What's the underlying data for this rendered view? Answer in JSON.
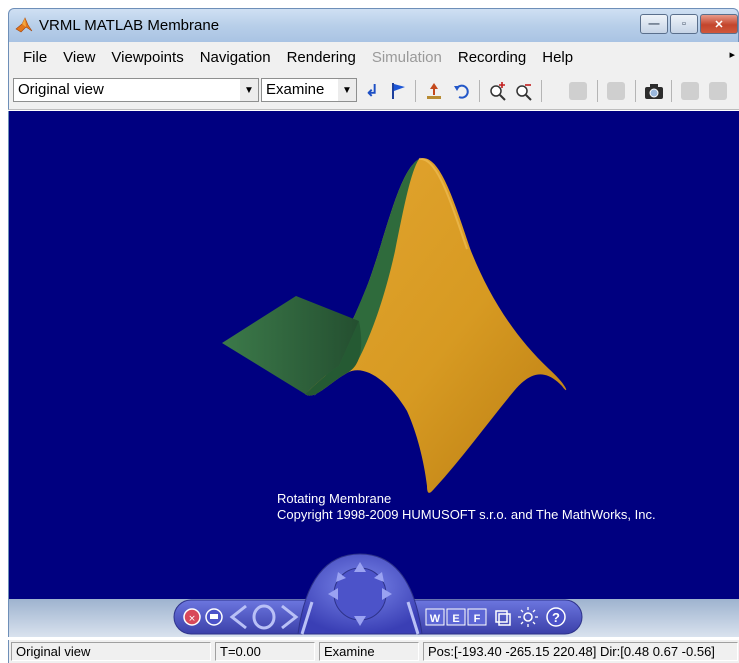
{
  "window": {
    "title": "VRML MATLAB Membrane",
    "minimize": "—",
    "maximize": "▫",
    "close": "✕"
  },
  "menu": [
    {
      "label": "File",
      "enabled": true
    },
    {
      "label": "View",
      "enabled": true
    },
    {
      "label": "Viewpoints",
      "enabled": true
    },
    {
      "label": "Navigation",
      "enabled": true
    },
    {
      "label": "Rendering",
      "enabled": true
    },
    {
      "label": "Simulation",
      "enabled": false
    },
    {
      "label": "Recording",
      "enabled": true
    },
    {
      "label": "Help",
      "enabled": true
    }
  ],
  "toolbar": {
    "viewpoint_select": "Original view",
    "navigation_mode_select": "Examine",
    "icons": [
      "return-to-viewpoint-icon",
      "create-viewpoint-icon",
      "straighten-up-icon",
      "undo-move-icon",
      "zoom-in-icon",
      "zoom-out-icon",
      "record-icon",
      "frame-icon",
      "snapshot-icon",
      "play-icon",
      "stop-icon"
    ]
  },
  "scene": {
    "caption_line1": "Rotating Membrane",
    "caption_line2": "Copyright 1998-2009 HUMUSOFT s.r.o. and The MathWorks, Inc.",
    "background_color": "#000080",
    "surface_color": "#d79a22",
    "surface_shadow_color": "#2f6b3c"
  },
  "navpanel": {
    "wireframe": "W",
    "headlight": "E",
    "fly": "F",
    "help": "?"
  },
  "status": {
    "viewpoint": "Original view",
    "time": "T=0.00",
    "mode": "Examine",
    "position": "Pos:[-193.40 -265.15 220.48] Dir:[0.48 0.67 -0.56]"
  }
}
